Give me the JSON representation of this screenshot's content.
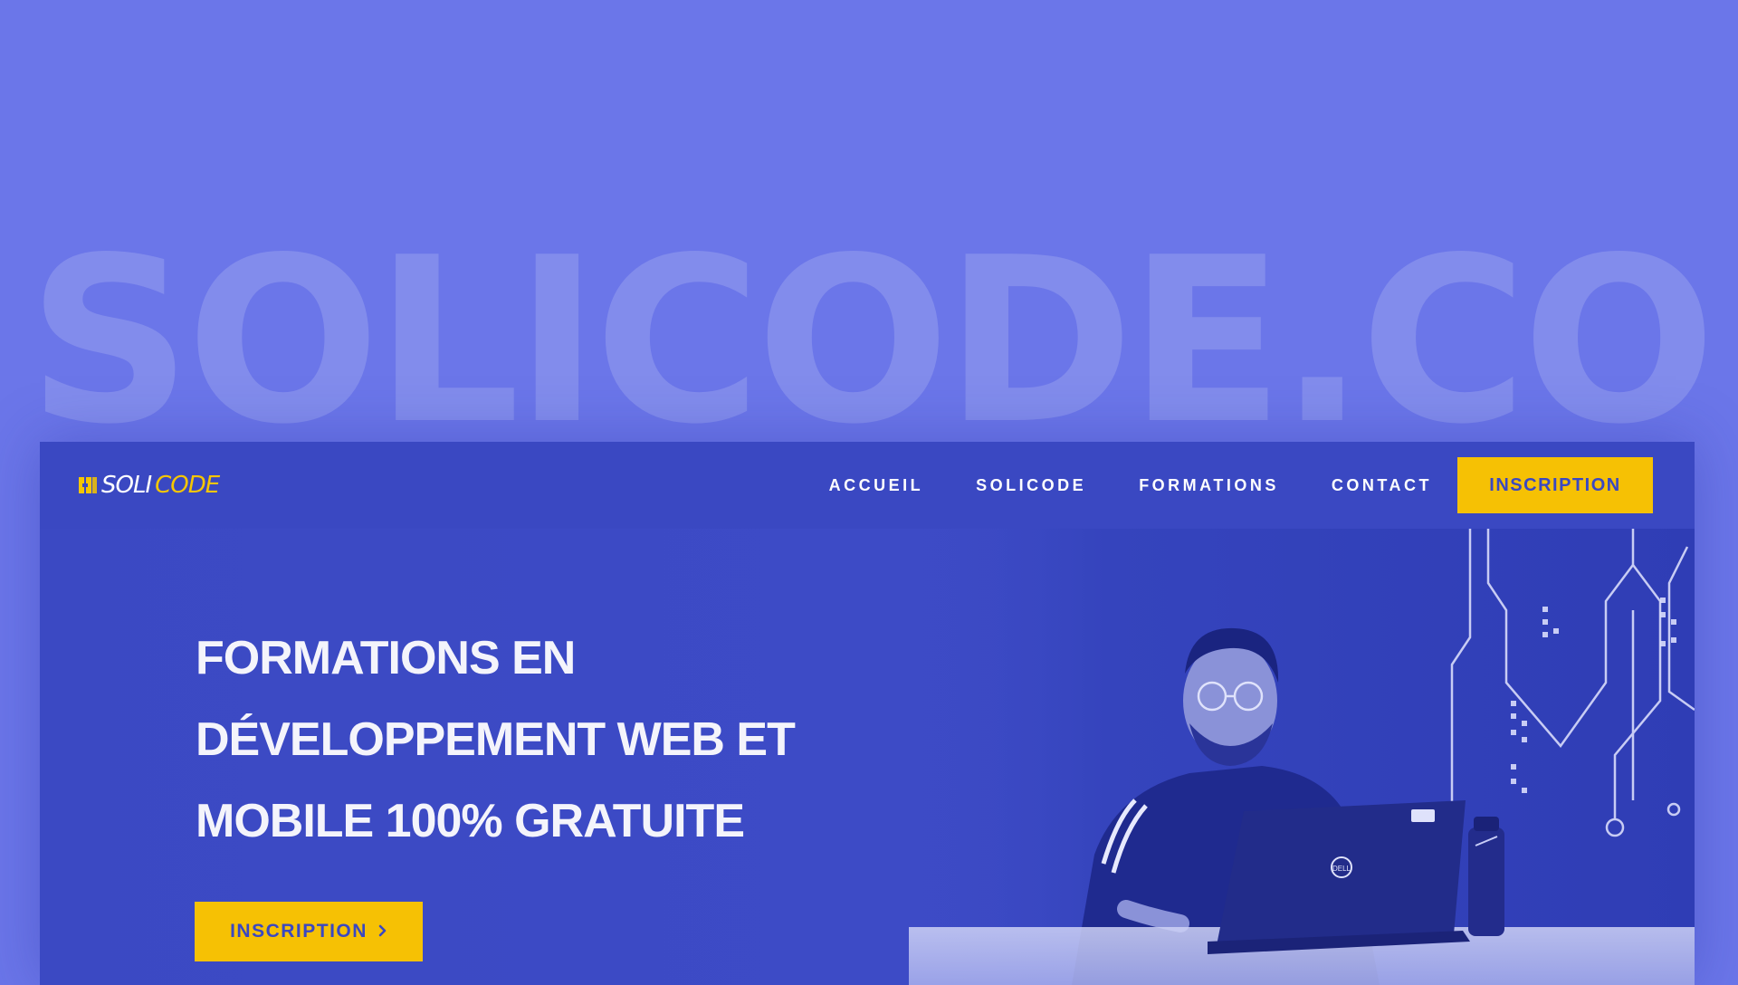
{
  "background_word": "SOLICODE.CO",
  "colors": {
    "page_bg": "#6b76e9",
    "nav_bg": "#3a48c2",
    "hero_bg": "#3d4bc5",
    "accent_yellow": "#f6c104",
    "text_white": "#ffffff"
  },
  "logo": {
    "part1": "SOLI",
    "part2": "CODE",
    "icon": "solicode-logo-icon"
  },
  "nav": {
    "links": [
      "ACCUEIL",
      "SOLICODE",
      "FORMATIONS",
      "CONTACT"
    ],
    "cta_label": "INSCRIPTION"
  },
  "hero": {
    "title_lines": [
      "FORMATIONS EN",
      "DÉVELOPPEMENT WEB ET",
      "MOBILE 100% GRATUITE"
    ],
    "cta_label": "INSCRIPTION",
    "cta_icon": "chevron-right-icon",
    "laptop_brand": "DELL"
  }
}
